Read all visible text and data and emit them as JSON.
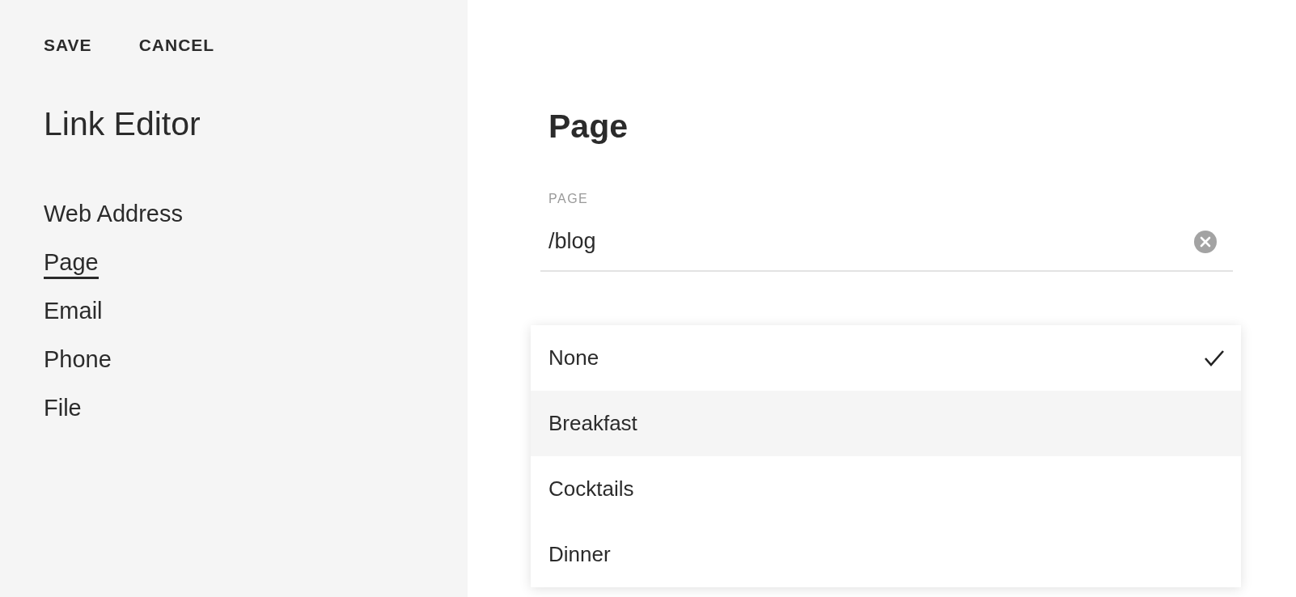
{
  "toolbar": {
    "buttons": [
      "SAVE",
      "CANCEL"
    ]
  },
  "sidebar": {
    "title": "Link Editor",
    "items": [
      {
        "label": "Web Address",
        "selected": false
      },
      {
        "label": "Page",
        "selected": true
      },
      {
        "label": "Email",
        "selected": false
      },
      {
        "label": "Phone",
        "selected": false
      },
      {
        "label": "File",
        "selected": false
      }
    ]
  },
  "main": {
    "title": "Page",
    "page_field": {
      "label": "PAGE",
      "value": "/blog"
    },
    "dropdown": {
      "options": [
        {
          "label": "None",
          "selected": true,
          "highlighted": false
        },
        {
          "label": "Breakfast",
          "selected": false,
          "highlighted": true
        },
        {
          "label": "Cocktails",
          "selected": false,
          "highlighted": false
        },
        {
          "label": "Dinner",
          "selected": false,
          "highlighted": false
        }
      ]
    }
  }
}
